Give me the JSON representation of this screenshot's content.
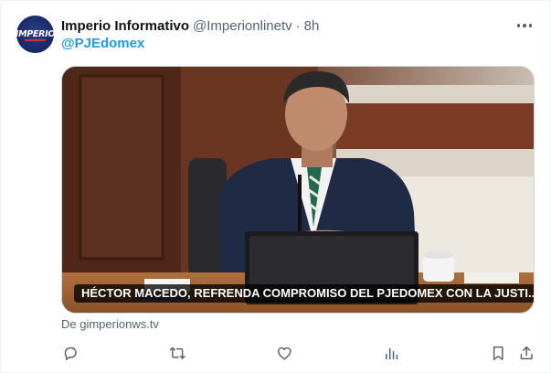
{
  "tweet": {
    "avatar_text": "IMPERIO",
    "display_name": "Imperio Informativo",
    "handle": "@Imperionlinetv",
    "separator": "·",
    "time": "8h",
    "mention": "@PJEdomex",
    "media_caption": "HÉCTOR MACEDO, REFRENDA COMPROMISO DEL PJEDOMEX CON LA JUSTI...",
    "source": "De gimperionws.tv"
  },
  "actions": [
    "reply-icon",
    "retweet-icon",
    "like-icon",
    "views-icon",
    "bookmark-icon",
    "share-icon"
  ],
  "colors": {
    "link": "#1d9bf0",
    "secondary_text": "#536471",
    "primary_text": "#0f1419"
  }
}
